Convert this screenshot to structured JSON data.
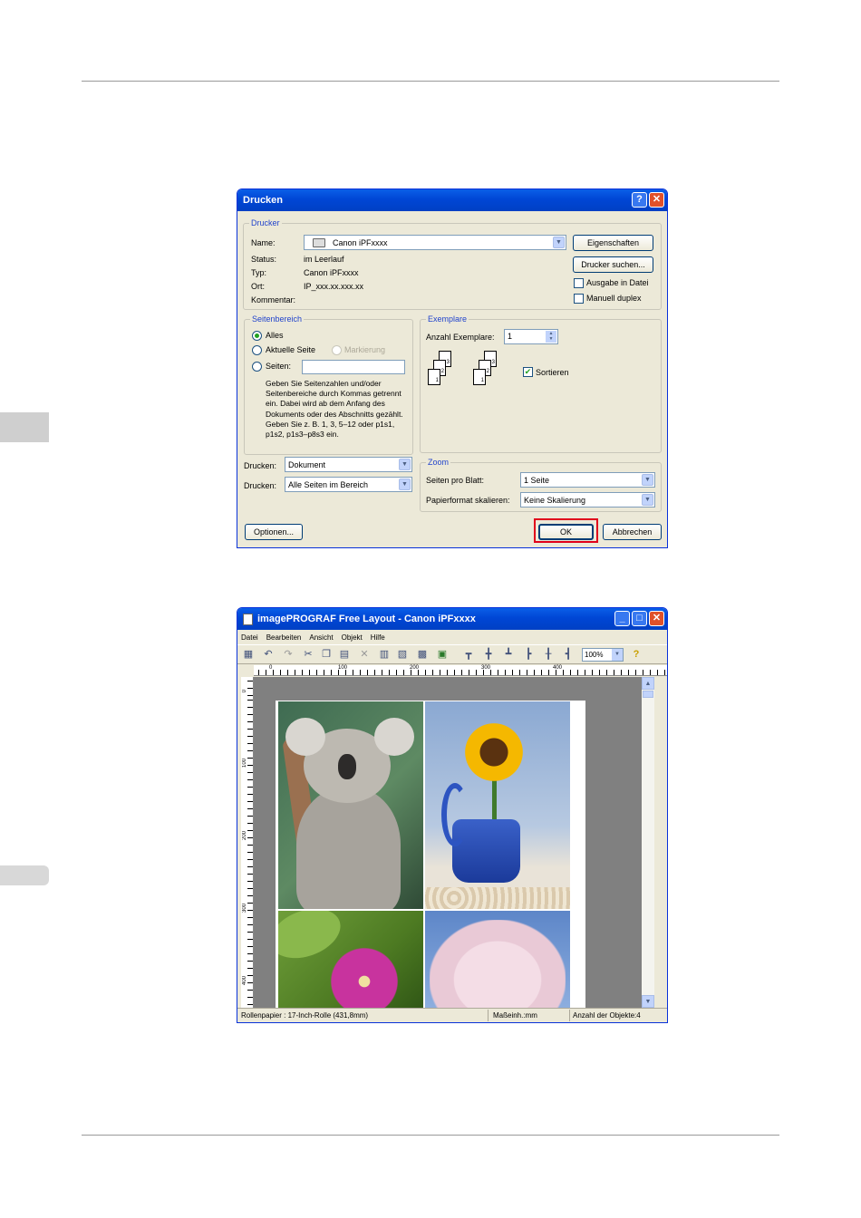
{
  "print_dialog": {
    "title": "Drucken",
    "help_glyph": "?",
    "close_glyph": "✕",
    "printer": {
      "group_label": "Drucker",
      "name_label": "Name:",
      "name_value": "Canon iPFxxxx",
      "status_label": "Status:",
      "status_value": "im Leerlauf",
      "type_label": "Typ:",
      "type_value": "Canon iPFxxxx",
      "location_label": "Ort:",
      "location_value": "IP_xxx.xx.xxx.xx",
      "comment_label": "Kommentar:",
      "properties_button": "Eigenschaften",
      "find_printer_button": "Drucker suchen...",
      "print_to_file_label": "Ausgabe in Datei",
      "manual_duplex_label": "Manuell duplex"
    },
    "page_range": {
      "group_label": "Seitenbereich",
      "all_label": "Alles",
      "current_page_label": "Aktuelle Seite",
      "selection_label": "Markierung",
      "pages_label": "Seiten:",
      "pages_value": "",
      "hint": "Geben Sie Seitenzahlen und/oder Seitenbereiche durch Kommas getrennt ein. Dabei wird ab dem Anfang des Dokuments oder des Abschnitts gezählt. Geben Sie z. B. 1, 3, 5–12 oder p1s1, p1s2, p1s3–p8s3 ein."
    },
    "copies": {
      "group_label": "Exemplare",
      "count_label": "Anzahl Exemplare:",
      "count_value": "1",
      "collate_label": "Sortieren",
      "collate_checked": true,
      "stack_numbers": [
        "3",
        "2",
        "1"
      ]
    },
    "print_what_label": "Drucken:",
    "print_what_value": "Dokument",
    "print_range_label": "Drucken:",
    "print_range_value": "Alle Seiten im Bereich",
    "zoom": {
      "group_label": "Zoom",
      "pages_per_sheet_label": "Seiten pro Blatt:",
      "pages_per_sheet_value": "1 Seite",
      "scale_label": "Papierformat skalieren:",
      "scale_value": "Keine Skalierung"
    },
    "options_button": "Optionen...",
    "ok_button": "OK",
    "cancel_button": "Abbrechen",
    "highlight_color": "#e0001b"
  },
  "layout_window": {
    "title": "imagePROGRAF Free Layout - Canon iPFxxxx",
    "menu": [
      "Datei",
      "Bearbeiten",
      "Ansicht",
      "Objekt",
      "Hilfe"
    ],
    "zoom_value": "100%",
    "ruler_h_labels": [
      "0",
      "100",
      "200",
      "300",
      "400"
    ],
    "ruler_v_labels": [
      "0",
      "100",
      "200",
      "300",
      "400"
    ],
    "status": {
      "paper": "Rollenpapier : 17-Inch-Rolle (431,8mm)",
      "unit": "Maßeinh.:mm",
      "objects": "Anzahl der Objekte:4"
    }
  }
}
